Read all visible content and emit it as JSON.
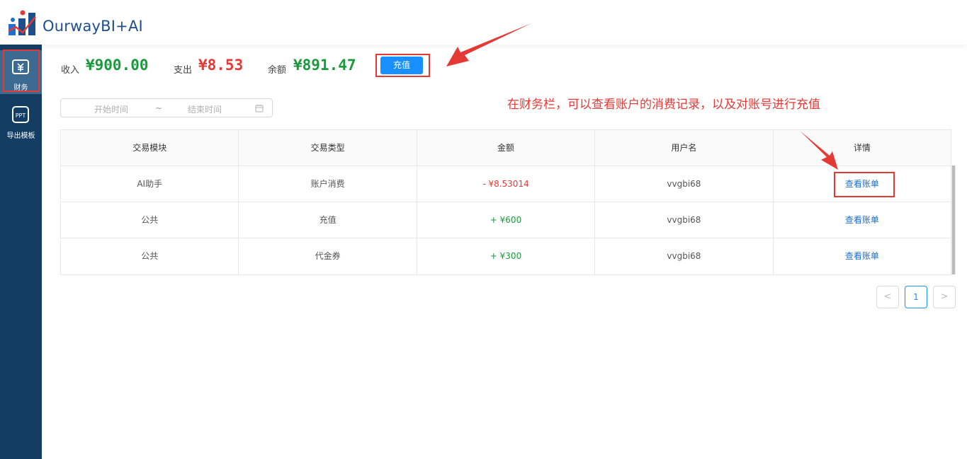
{
  "app": {
    "title": "OurwayBI+AI"
  },
  "sidebar": {
    "items": [
      {
        "label": "财务",
        "icon": "yuan-wallet-icon",
        "active": true
      },
      {
        "label": "导出模板",
        "icon": "ppt-icon",
        "active": false
      }
    ]
  },
  "summary": {
    "income_label": "收入",
    "income_value": "¥900.00",
    "expense_label": "支出",
    "expense_value": "¥8.53",
    "balance_label": "余额",
    "balance_value": "¥891.47",
    "recharge_label": "充值"
  },
  "filter": {
    "start_placeholder": "开始时间",
    "separator": "~",
    "end_placeholder": "结束时间"
  },
  "annotation": "在财务栏，可以查看账户的消费记录，以及对账号进行充值",
  "table": {
    "headers": [
      "交易模块",
      "交易类型",
      "金额",
      "用户名",
      "详情"
    ],
    "rows": [
      {
        "module": "AI助手",
        "type": "账户消费",
        "amount": "- ¥8.53014",
        "user": "vvgbi68",
        "detail": "查看账单"
      },
      {
        "module": "公共",
        "type": "充值",
        "amount": "+ ¥600",
        "user": "vvgbi68",
        "detail": "查看账单"
      },
      {
        "module": "公共",
        "type": "代金券",
        "amount": "+ ¥300",
        "user": "vvgbi68",
        "detail": "查看账单"
      }
    ]
  },
  "pagination": {
    "prev": "<",
    "current": "1",
    "next": ">"
  },
  "colors": {
    "accent": "#1890ff",
    "positive": "#1a9a3c",
    "negative": "#e53935",
    "sidebar": "#143d64"
  }
}
